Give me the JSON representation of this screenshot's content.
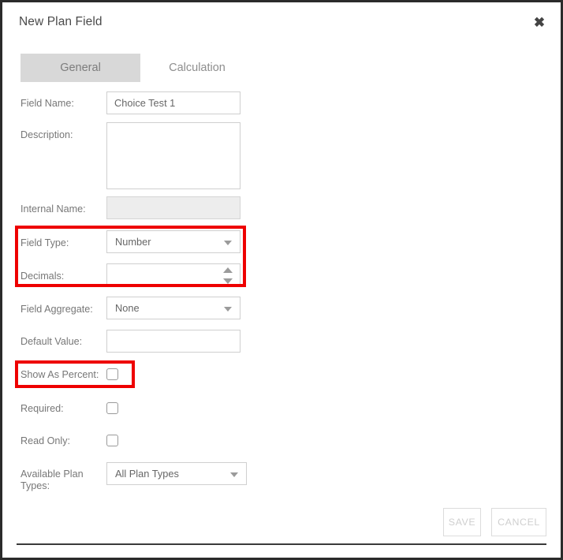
{
  "dialog": {
    "title": "New Plan Field",
    "close_icon": "close-icon"
  },
  "tabs": [
    {
      "label": "General",
      "active": true
    },
    {
      "label": "Calculation",
      "active": false
    }
  ],
  "form": {
    "field_name": {
      "label": "Field Name:",
      "value": "Choice Test 1",
      "placeholder": ""
    },
    "description": {
      "label": "Description:",
      "value": "",
      "placeholder": ""
    },
    "internal_name": {
      "label": "Internal Name:",
      "value": "",
      "placeholder": "",
      "disabled": true
    },
    "field_type": {
      "label": "Field Type:",
      "value": "Number",
      "caret_icon": "chevron-down-icon"
    },
    "decimals": {
      "label": "Decimals:",
      "value": "",
      "spinner_icon": "up-down-arrows-icon"
    },
    "field_aggregate": {
      "label": "Field Aggregate:",
      "value": "None",
      "caret_icon": "chevron-down-icon"
    },
    "default_value": {
      "label": "Default Value:",
      "value": "",
      "placeholder": ""
    },
    "show_as_percent": {
      "label": "Show As Percent:",
      "checked": false
    },
    "required": {
      "label": "Required:",
      "checked": false
    },
    "read_only": {
      "label": "Read Only:",
      "checked": false
    },
    "available_plan_types": {
      "label": "Available Plan Types:",
      "value": "All Plan Types",
      "caret_icon": "chevron-down-icon"
    }
  },
  "footer": {
    "save_label": "SAVE",
    "cancel_label": "CANCEL"
  },
  "annotations": {
    "highlight_color": "#ee0000",
    "boxes": [
      {
        "name": "field-type-decimals-highlight"
      },
      {
        "name": "show-as-percent-highlight"
      }
    ]
  }
}
